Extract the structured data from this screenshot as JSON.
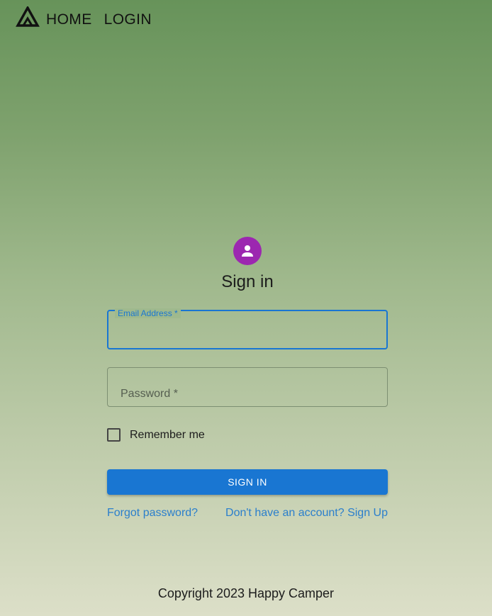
{
  "nav": {
    "logo_icon": "tent-logo-icon",
    "home_label": "HOME",
    "login_label": "LOGIN"
  },
  "signin": {
    "avatar_icon": "person-icon",
    "avatar_color": "#9c27b0",
    "title": "Sign in",
    "email_label": "Email Address *",
    "email_value": "",
    "password_label": "Password *",
    "password_value": "",
    "remember_label": "Remember me",
    "remember_checked": false,
    "submit_label": "SIGN IN",
    "forgot_label": "Forgot password?",
    "signup_label": "Don't have an account? Sign Up"
  },
  "colors": {
    "accent": "#1976d2",
    "link": "#2b7fcc"
  },
  "footer": {
    "copyright": "Copyright 2023 Happy Camper"
  }
}
